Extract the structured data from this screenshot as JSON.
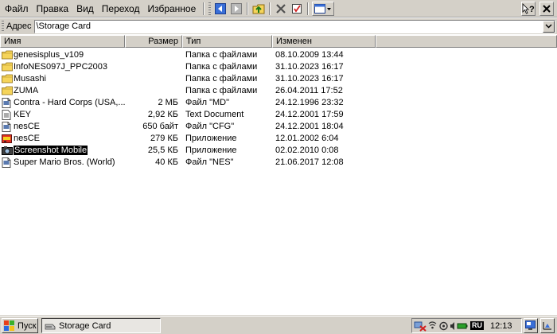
{
  "menu": {
    "file": "Файл",
    "edit": "Правка",
    "view": "Вид",
    "go": "Переход",
    "favorites": "Избранное"
  },
  "toolbar": {
    "icons": [
      "back-arrow-icon",
      "forward-arrow-icon",
      "up-folder-icon",
      "delete-icon",
      "properties-icon",
      "views-icon",
      "help-icon",
      "close-icon"
    ]
  },
  "address": {
    "label": "Адрес",
    "value": "\\Storage Card"
  },
  "columns": {
    "name": "Имя",
    "size": "Размер",
    "type": "Тип",
    "modified": "Изменен"
  },
  "files": [
    {
      "name": "genesisplus_v109",
      "size": "",
      "type": "Папка с файлами",
      "modified": "08.10.2009 13:44",
      "icon": "folder-icon"
    },
    {
      "name": "InfoNES097J_PPC2003",
      "size": "",
      "type": "Папка с файлами",
      "modified": "31.10.2023 16:17",
      "icon": "folder-icon"
    },
    {
      "name": "Musashi",
      "size": "",
      "type": "Папка с файлами",
      "modified": "31.10.2023 16:17",
      "icon": "folder-icon"
    },
    {
      "name": "ZUMA",
      "size": "",
      "type": "Папка с файлами",
      "modified": "26.04.2011 17:52",
      "icon": "folder-icon"
    },
    {
      "name": "Contra - Hard Corps (USA,...",
      "size": "2 МБ",
      "type": "Файл \"MD\"",
      "modified": "24.12.1996 23:32",
      "icon": "file-icon"
    },
    {
      "name": "KEY",
      "size": "2,92 КБ",
      "type": "Text Document",
      "modified": "24.12.2001 17:59",
      "icon": "text-document-icon"
    },
    {
      "name": "nesCE",
      "size": "650 байт",
      "type": "Файл \"CFG\"",
      "modified": "24.12.2001 18:04",
      "icon": "file-icon"
    },
    {
      "name": "nesCE",
      "size": "279 КБ",
      "type": "Приложение",
      "modified": "12.01.2002 6:04",
      "icon": "nes-app-icon"
    },
    {
      "name": "Screenshot Mobile",
      "size": "25,5 КБ",
      "type": "Приложение",
      "modified": "02.02.2010 0:08",
      "icon": "camera-app-icon",
      "selected": true
    },
    {
      "name": "Super Mario Bros. (World)",
      "size": "40 КБ",
      "type": "Файл \"NES\"",
      "modified": "21.06.2017 12:08",
      "icon": "file-icon"
    }
  ],
  "taskbar": {
    "start_label": "Пуск",
    "task_label": "Storage Card",
    "language": "RU",
    "clock": "12:13"
  },
  "colors": {
    "chrome": "#d4d0c8",
    "selection": "#000000",
    "folder": "#f5d45a"
  }
}
